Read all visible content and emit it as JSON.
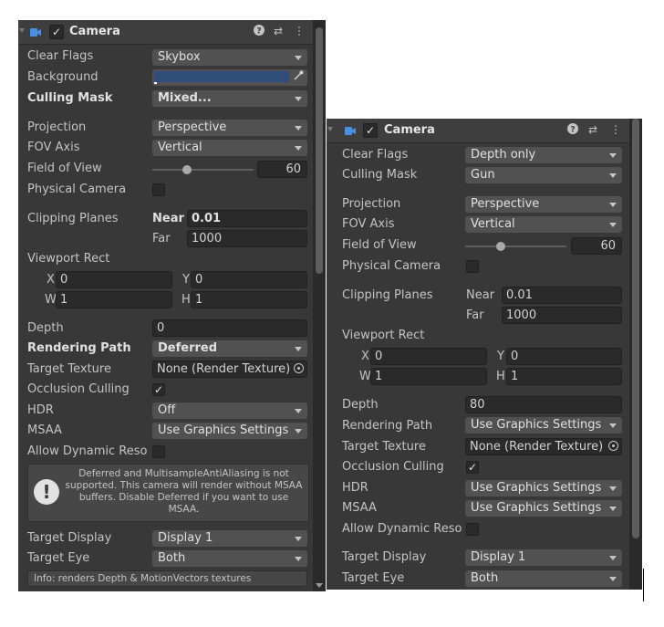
{
  "panel1": {
    "header": {
      "title": "Camera"
    },
    "clear_flags": {
      "label": "Clear Flags",
      "value": "Skybox"
    },
    "background": {
      "label": "Background",
      "color": "#314d79"
    },
    "culling_mask": {
      "label": "Culling Mask",
      "value": "Mixed..."
    },
    "projection": {
      "label": "Projection",
      "value": "Perspective"
    },
    "fov_axis": {
      "label": "FOV Axis",
      "value": "Vertical"
    },
    "field_of_view": {
      "label": "Field of View",
      "value": "60"
    },
    "physical_camera": {
      "label": "Physical Camera"
    },
    "clipping_planes": {
      "label": "Clipping Planes",
      "near_label": "Near",
      "near": "0.01",
      "far_label": "Far",
      "far": "1000"
    },
    "viewport_rect": {
      "label": "Viewport Rect",
      "x_label": "X",
      "x": "0",
      "y_label": "Y",
      "y": "0",
      "w_label": "W",
      "w": "1",
      "h_label": "H",
      "h": "1"
    },
    "depth": {
      "label": "Depth",
      "value": "0"
    },
    "rendering_path": {
      "label": "Rendering Path",
      "value": "Deferred"
    },
    "target_texture": {
      "label": "Target Texture",
      "value": "None (Render Texture)"
    },
    "occlusion_culling": {
      "label": "Occlusion Culling",
      "check": "✓"
    },
    "hdr": {
      "label": "HDR",
      "value": "Off"
    },
    "msaa": {
      "label": "MSAA",
      "value": "Use Graphics Settings"
    },
    "allow_dynamic": {
      "label": "Allow Dynamic Reso"
    },
    "help": {
      "text": "Deferred and MultisampleAntiAliasing is not supported. This camera will render without MSAA buffers. Disable Deferred if you want to use MSAA."
    },
    "target_display": {
      "label": "Target Display",
      "value": "Display 1"
    },
    "target_eye": {
      "label": "Target Eye",
      "value": "Both"
    },
    "info": {
      "text": "Info: renders Depth & MotionVectors textures"
    }
  },
  "panel2": {
    "header": {
      "title": "Camera"
    },
    "clear_flags": {
      "label": "Clear Flags",
      "value": "Depth only"
    },
    "culling_mask": {
      "label": "Culling Mask",
      "value": "Gun"
    },
    "projection": {
      "label": "Projection",
      "value": "Perspective"
    },
    "fov_axis": {
      "label": "FOV Axis",
      "value": "Vertical"
    },
    "field_of_view": {
      "label": "Field of View",
      "value": "60"
    },
    "physical_camera": {
      "label": "Physical Camera"
    },
    "clipping_planes": {
      "label": "Clipping Planes",
      "near_label": "Near",
      "near": "0.01",
      "far_label": "Far",
      "far": "1000"
    },
    "viewport_rect": {
      "label": "Viewport Rect",
      "x_label": "X",
      "x": "0",
      "y_label": "Y",
      "y": "0",
      "w_label": "W",
      "w": "1",
      "h_label": "H",
      "h": "1"
    },
    "depth": {
      "label": "Depth",
      "value": "80"
    },
    "rendering_path": {
      "label": "Rendering Path",
      "value": "Use Graphics Settings"
    },
    "target_texture": {
      "label": "Target Texture",
      "value": "None (Render Texture)"
    },
    "occlusion_culling": {
      "label": "Occlusion Culling",
      "check": "✓"
    },
    "hdr": {
      "label": "HDR",
      "value": "Use Graphics Settings"
    },
    "msaa": {
      "label": "MSAA",
      "value": "Use Graphics Settings"
    },
    "allow_dynamic": {
      "label": "Allow Dynamic Reso"
    },
    "target_display": {
      "label": "Target Display",
      "value": "Display 1"
    },
    "target_eye": {
      "label": "Target Eye",
      "value": "Both"
    }
  },
  "icons": {
    "help": "?",
    "presets": "⇄",
    "menu": "⋮",
    "check": "✓",
    "eyedropper": "⚲",
    "warning": "!"
  },
  "colors": {
    "accent_camera_icon": "#4a90e2",
    "panel_bg": "#383838",
    "field_bg": "#2a2a2a",
    "dropdown_bg": "#515151"
  }
}
